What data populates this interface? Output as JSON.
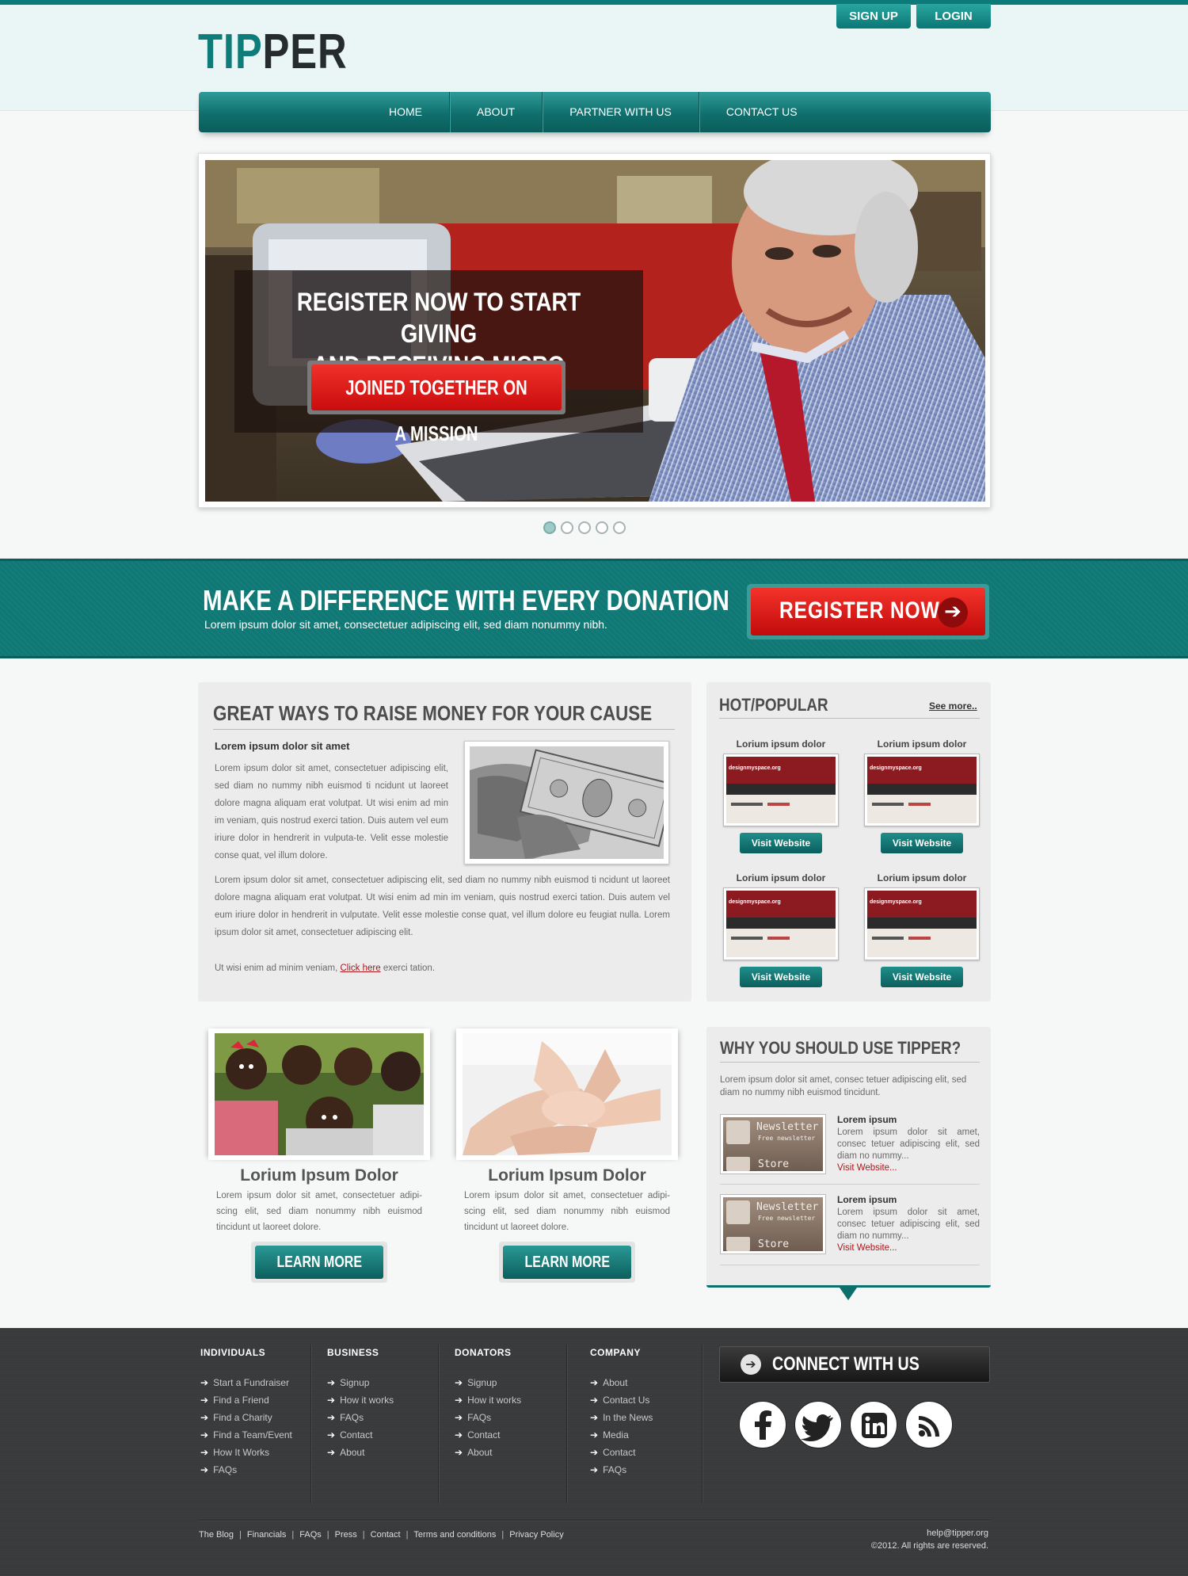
{
  "header": {
    "logo_part1": "TIP",
    "logo_part2": "PER",
    "signup_label": "SIGN UP",
    "login_label": "LOGIN"
  },
  "nav": {
    "items": [
      "HOME",
      "ABOUT",
      "PARTNER WITH US",
      "CONTACT US"
    ]
  },
  "slider": {
    "headline_line1": "REGISTER NOW TO START GIVING",
    "headline_line2": "AND RECEIVING MICRO DONATIONS!",
    "button_label": "JOINED TOGETHER ON A MISSION",
    "slide_count": 5,
    "active_slide": 1
  },
  "band": {
    "title": "MAKE A DIFFERENCE WITH EVERY DONATION",
    "subtitle": "Lorem ipsum dolor sit amet, consectetuer adipiscing elit, sed diam nonummy nibh.",
    "button_label": "REGISTER NOW"
  },
  "raise": {
    "title": "GREAT WAYS TO RAISE MONEY FOR YOUR CAUSE",
    "subtitle": "Lorem ipsum dolor sit amet",
    "para1": "Lorem ipsum dolor sit amet, consectetuer adipiscing elit, sed diam no nummy nibh euismod ti ncidunt ut laoreet dolore magna aliquam erat volutpat. Ut wisi enim ad min im veniam, quis nostrud exerci tation. Duis autem vel eum iriure dolor in hendrerit in vulputa-te. Velit esse molestie conse quat, vel illum dolore.",
    "para2": "Lorem ipsum dolor sit amet, consectetuer adipiscing elit, sed diam no nummy nibh euismod ti ncidunt ut laoreet dolore magna aliquam erat volutpat. Ut wisi enim ad min im veniam, quis nostrud exerci tation. Duis autem vel eum iriure dolor in hendrerit in vulputate. Velit esse molestie conse quat, vel illum dolore eu feugiat nulla. Lorem ipsum dolor sit amet, consectetuer adipiscing elit.",
    "para3_before": "Ut wisi enim ad minim veniam, ",
    "para3_link": "Click here",
    "para3_after": " exerci tation."
  },
  "hot": {
    "title": "HOT/POPULAR",
    "see_more": "See more..",
    "items": [
      {
        "title": "Lorium ipsum dolor",
        "thumb_text": "designmyspace.org",
        "button": "Visit Website"
      },
      {
        "title": "Lorium ipsum dolor",
        "thumb_text": "designmyspace.org",
        "button": "Visit Website"
      },
      {
        "title": "Lorium ipsum dolor",
        "thumb_text": "designmyspace.org",
        "button": "Visit Website"
      },
      {
        "title": "Lorium ipsum dolor",
        "thumb_text": "designmyspace.org",
        "button": "Visit Website"
      }
    ]
  },
  "features": [
    {
      "title": "Lorium Ipsum Dolor",
      "desc": "Lorem ipsum dolor sit amet, consectetuer adipi-scing elit, sed diam nonummy nibh euismod tincidunt ut laoreet dolore.",
      "button": "LEARN MORE"
    },
    {
      "title": "Lorium Ipsum Dolor",
      "desc": "Lorem ipsum dolor sit amet, consectetuer adipi-scing elit, sed diam nonummy nibh euismod tincidunt ut laoreet dolore.",
      "button": "LEARN MORE"
    }
  ],
  "why": {
    "title": "WHY YOU SHOULD USE TIPPER?",
    "text": "Lorem ipsum dolor sit amet, consec tetuer adipiscing elit, sed diam no nummy nibh euismod tincidunt.",
    "items": [
      {
        "heading": "Lorem ipsum",
        "desc": "Lorem ipsum dolor sit amet, consec tetuer adipiscing elit, sed diam no nummy...",
        "link": "Visit Website...",
        "img_title": "Newsletter",
        "img_sub": "Free newsletter",
        "img_store": "Store"
      },
      {
        "heading": "Lorem ipsum",
        "desc": "Lorem ipsum dolor sit amet, consec tetuer adipiscing elit, sed diam no nummy...",
        "link": "Visit Website...",
        "img_title": "Newsletter",
        "img_sub": "Free newsletter",
        "img_store": "Store"
      }
    ]
  },
  "footer": {
    "columns": [
      {
        "title": "INDIVIDUALS",
        "links": [
          "Start a Fundraiser",
          "Find a Friend",
          "Find a Charity",
          "Find a Team/Event",
          "How It Works",
          "FAQs"
        ]
      },
      {
        "title": "BUSINESS",
        "links": [
          "Signup",
          "How it works",
          "FAQs",
          "Contact",
          "About"
        ]
      },
      {
        "title": "DONATORS",
        "links": [
          "Signup",
          "How it works",
          "FAQs",
          "Contact",
          "About"
        ]
      },
      {
        "title": "COMPANY",
        "links": [
          "About",
          "Contact Us",
          "In the News",
          "Media",
          "Contact",
          "FAQs"
        ]
      }
    ],
    "connect_title": "CONNECT WITH US",
    "social_icons": [
      "facebook-icon",
      "twitter-icon",
      "linkedin-icon",
      "rss-icon"
    ],
    "bottom_links": [
      "The Blog",
      "Financials",
      "FAQs",
      "Press",
      "Contact",
      "Terms and conditions",
      "Privacy Policy"
    ],
    "email": "help@tipper.org",
    "copyright": "©2012. All rights are reserved."
  },
  "colors": {
    "brand_teal": "#0e7d79",
    "accent_red": "#d71a14",
    "footer_bg": "#393a3b"
  }
}
